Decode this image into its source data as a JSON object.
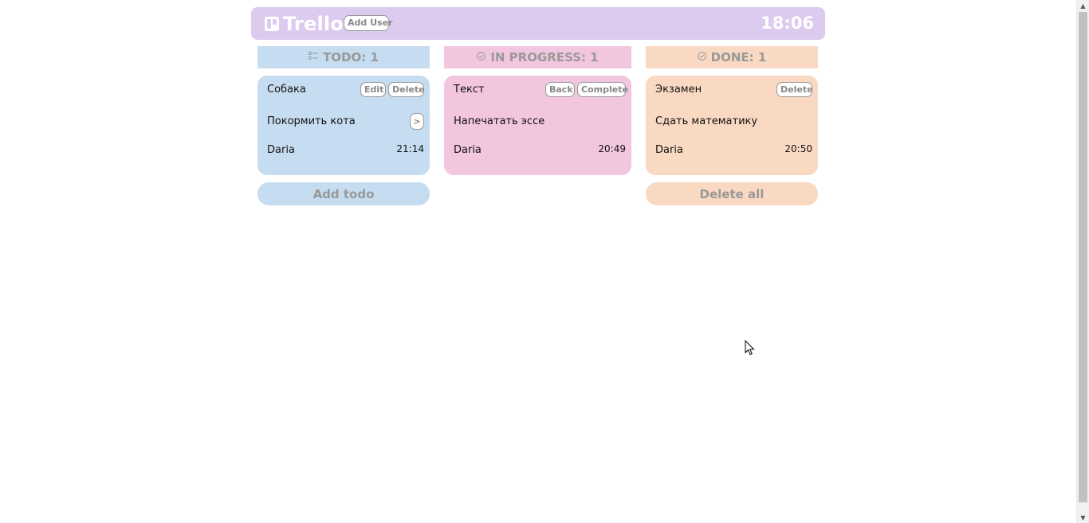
{
  "header": {
    "logo_text": "Trello",
    "add_user_label": "Add User",
    "clock": "18:06"
  },
  "columns": {
    "todo": {
      "title": "TODO: 1",
      "icon": "list-icon",
      "card": {
        "title": "Собака",
        "edit_label": "Edit",
        "delete_label": "Delete",
        "description": "Покормить кота",
        "move_label": ">",
        "user": "Daria",
        "time": "21:14"
      },
      "add_label": "Add todo"
    },
    "in_progress": {
      "title": "IN PROGRESS: 1",
      "icon": "clock-check-icon",
      "card": {
        "title": "Текст",
        "back_label": "Back",
        "complete_label": "Complete",
        "description": "Напечатать эссе",
        "user": "Daria",
        "time": "20:49"
      }
    },
    "done": {
      "title": "DONE: 1",
      "icon": "check-circle-icon",
      "card": {
        "title": "Экзамен",
        "delete_label": "Delete",
        "description": "Сдать математику",
        "user": "Daria",
        "time": "20:50"
      },
      "delete_all_label": "Delete all"
    }
  },
  "colors": {
    "header": "#dccbee",
    "todo": "#c6dcf0",
    "in_progress": "#f3c6df",
    "done": "#f9d9c2"
  }
}
